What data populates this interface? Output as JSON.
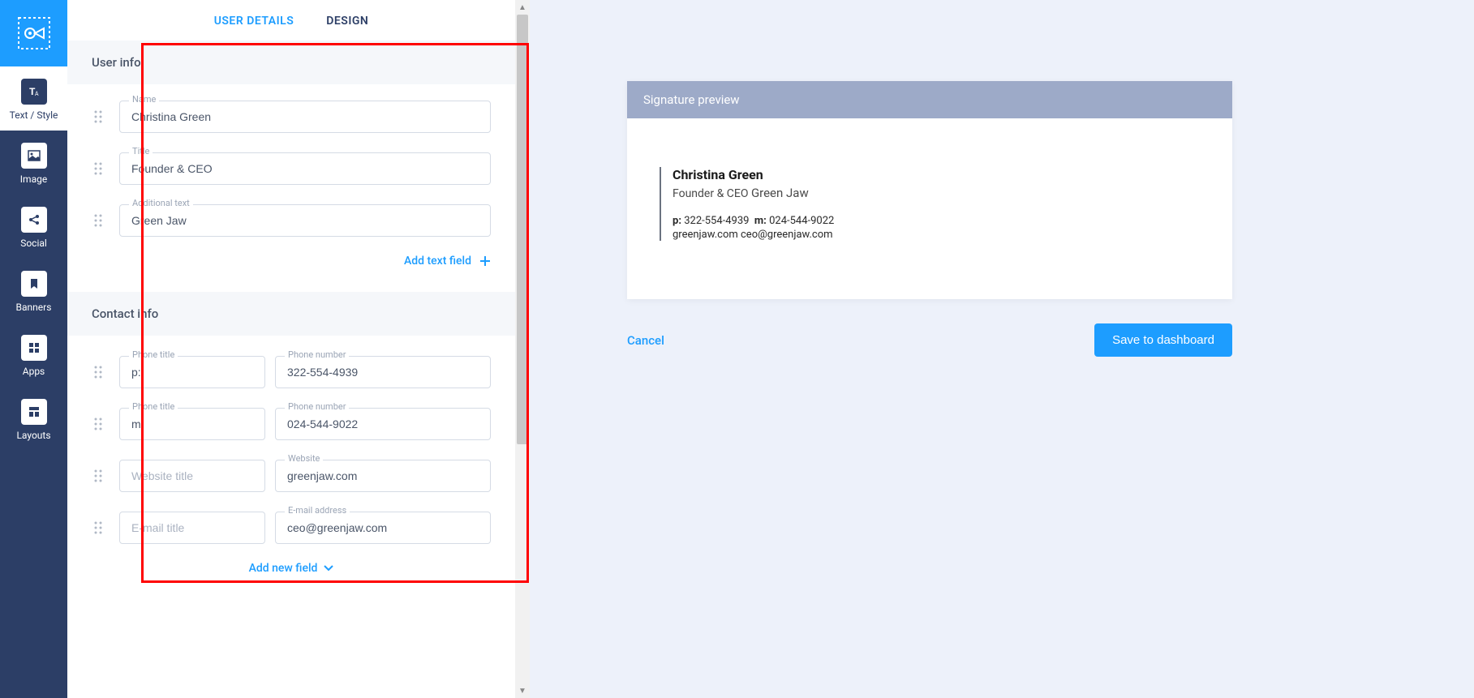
{
  "sidebar": {
    "items": [
      {
        "label": "Text / Style"
      },
      {
        "label": "Image"
      },
      {
        "label": "Social"
      },
      {
        "label": "Banners"
      },
      {
        "label": "Apps"
      },
      {
        "label": "Layouts"
      }
    ]
  },
  "tabs": {
    "user_details": "USER DETAILS",
    "design": "DESIGN"
  },
  "sections": {
    "user_info": "User info",
    "contact_info": "Contact info"
  },
  "user_fields": {
    "name_label": "Name",
    "name_value": "Christina Green",
    "title_label": "Title",
    "title_value": "Founder & CEO",
    "additional_label": "Additional text",
    "additional_value": "Green Jaw"
  },
  "add_text_field": "Add text field",
  "add_new_field": "Add new field",
  "contact_fields": {
    "phone1_title_label": "Phone title",
    "phone1_title_value": "p:",
    "phone1_num_label": "Phone number",
    "phone1_num_value": "322-554-4939",
    "phone2_title_label": "Phone title",
    "phone2_title_value": "m:",
    "phone2_num_label": "Phone number",
    "phone2_num_value": "024-544-9022",
    "website_title_label": "",
    "website_title_placeholder": "Website title",
    "website_label": "Website",
    "website_value": "greenjaw.com",
    "email_title_label": "",
    "email_title_placeholder": "E-mail title",
    "email_label": "E-mail address",
    "email_value": "ceo@greenjaw.com"
  },
  "preview": {
    "header": "Signature preview",
    "name": "Christina Green",
    "title": "Founder & CEO",
    "company": "Green Jaw",
    "p_label": "p:",
    "p_value": "322-554-4939",
    "m_label": "m:",
    "m_value": "024-544-9022",
    "website": "greenjaw.com",
    "email": "ceo@greenjaw.com"
  },
  "actions": {
    "cancel": "Cancel",
    "save": "Save to dashboard"
  }
}
